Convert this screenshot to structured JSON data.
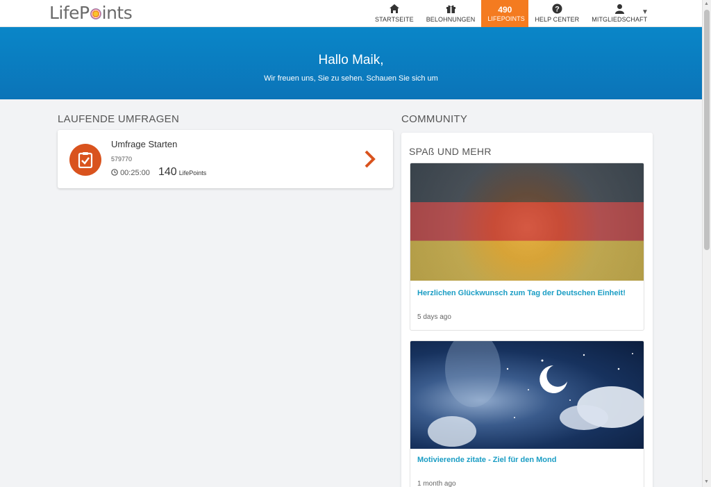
{
  "brand": {
    "logo_left": "LifeP",
    "logo_right": "ints"
  },
  "nav": {
    "items": [
      {
        "icon": "home-icon",
        "label": "STARTSEITE"
      },
      {
        "icon": "gift-icon",
        "label": "BELOHNUNGEN"
      },
      {
        "icon": "points-badge",
        "value": "490",
        "label": "LIFEPOINTS"
      },
      {
        "icon": "question-circle-icon",
        "label": "HELP CENTER"
      },
      {
        "icon": "user-icon",
        "label": "MITGLIEDSCHAFT"
      }
    ]
  },
  "hero": {
    "greeting": "Hallo Maik,",
    "subtitle": "Wir freuen uns, Sie zu sehen. Schauen Sie sich um"
  },
  "surveys": {
    "section_title": "LAUFENDE UMFRAGEN",
    "card": {
      "title": "Umfrage Starten",
      "id": "579770",
      "duration": "00:25:00",
      "points": "140",
      "points_label": "LifePoints"
    }
  },
  "community": {
    "section_title": "COMMUNITY",
    "subsection_title": "SPAß UND MEHR",
    "articles": [
      {
        "title": "Herzlichen Glückwunsch zum Tag der Deutschen Einheit!",
        "date": "5 days ago"
      },
      {
        "title": "Motivierende zitate - Ziel für den Mond",
        "date": "1 month ago"
      }
    ]
  },
  "colors": {
    "accent_orange": "#f47b20",
    "survey_icon": "#d9531e",
    "hero_blue": "#0a86c8",
    "link_blue": "#1a9dc4"
  }
}
